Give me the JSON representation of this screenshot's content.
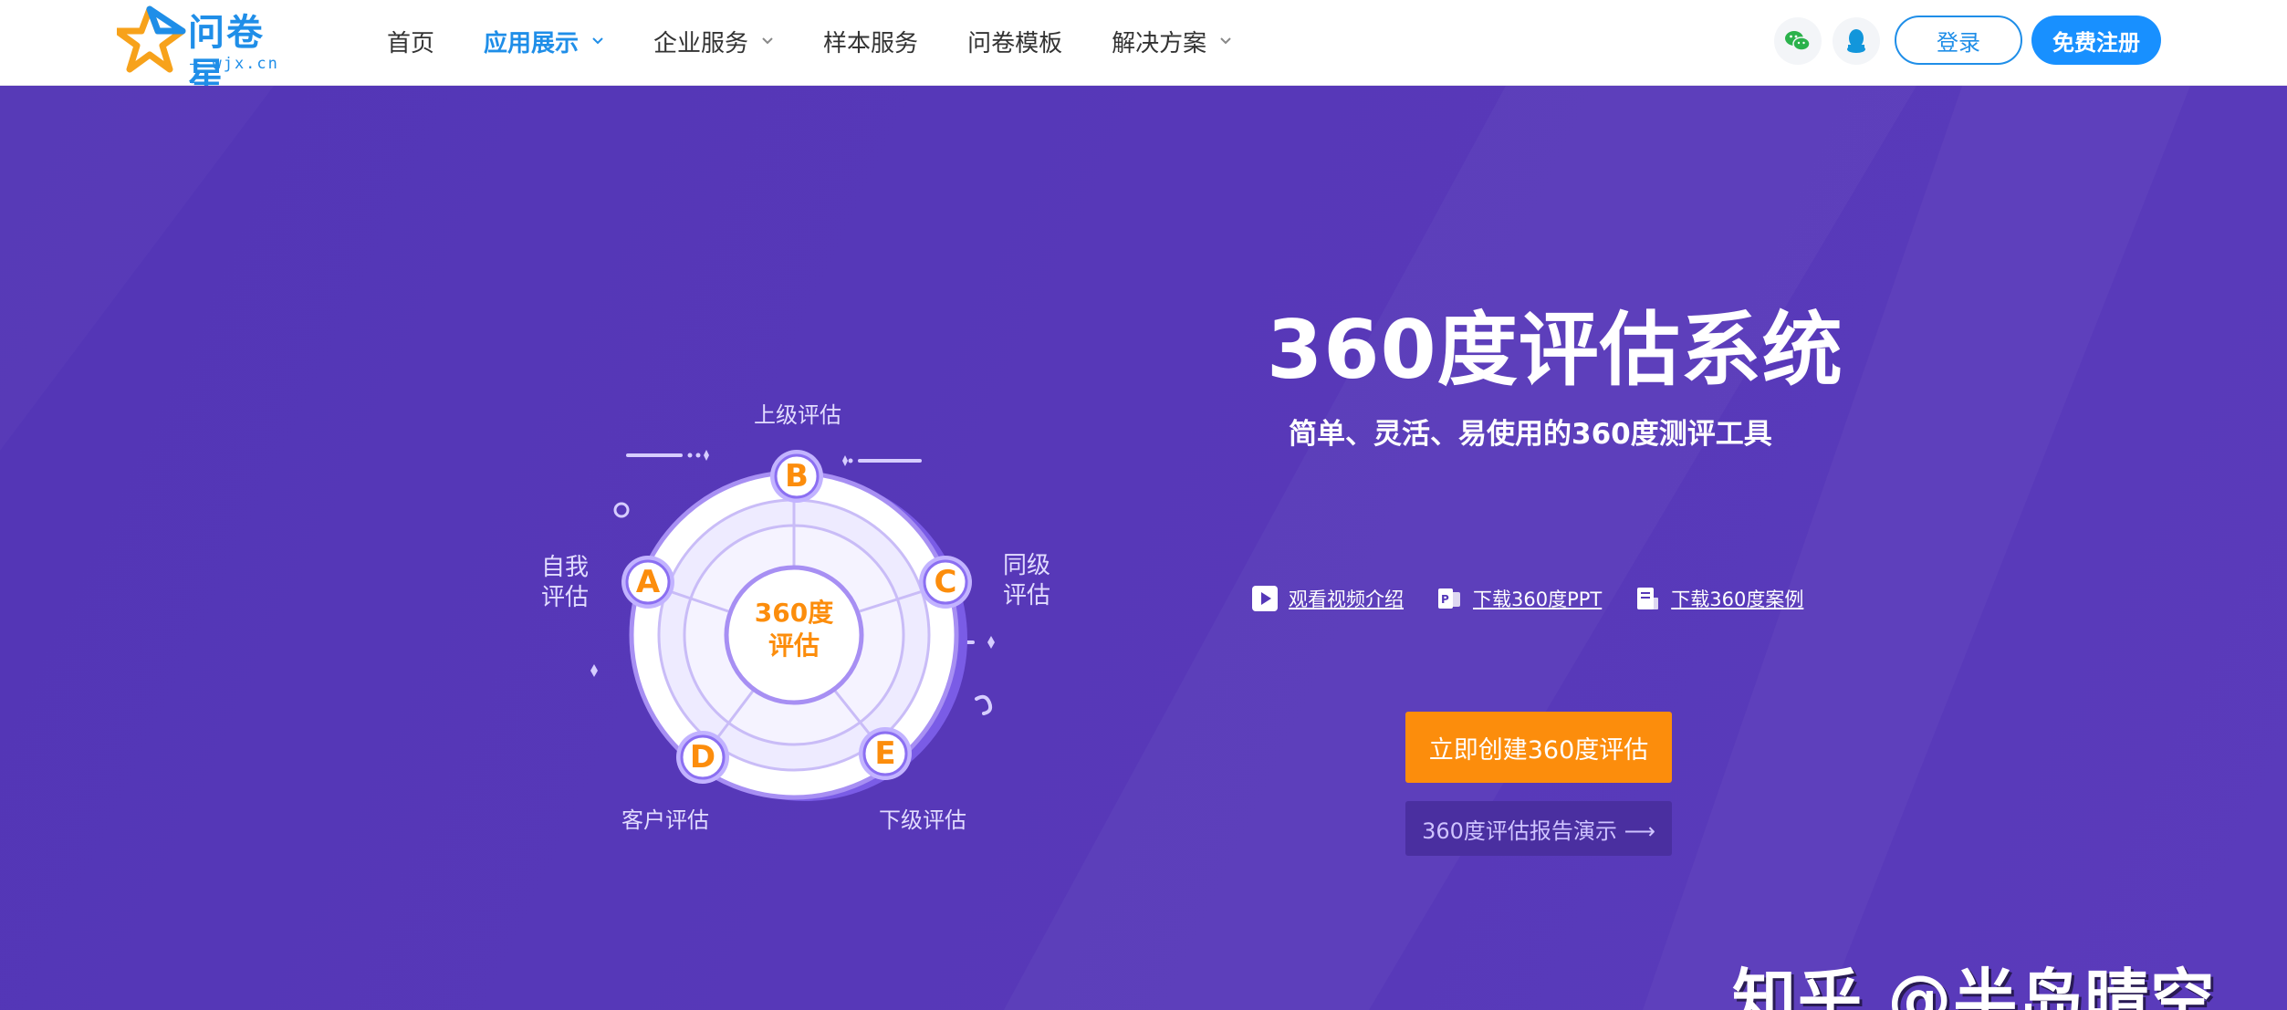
{
  "brand": {
    "name": "问卷星",
    "domain": "— wjx.cn —",
    "colors": {
      "primary": "#1f8ee8",
      "star_orange": "#f7a21b"
    }
  },
  "nav": {
    "items": [
      {
        "label": "首页",
        "active": false,
        "dropdown": false
      },
      {
        "label": "应用展示",
        "active": true,
        "dropdown": true
      },
      {
        "label": "企业服务",
        "active": false,
        "dropdown": true
      },
      {
        "label": "样本服务",
        "active": false,
        "dropdown": false
      },
      {
        "label": "问卷模板",
        "active": false,
        "dropdown": false
      },
      {
        "label": "解决方案",
        "active": false,
        "dropdown": true
      }
    ]
  },
  "header_actions": {
    "wechat_icon": "wechat-icon",
    "qq_icon": "qq-icon",
    "login_label": "登录",
    "register_label": "免费注册"
  },
  "hero": {
    "background": "#5538b8",
    "title": "360度评估系统",
    "subtitle": "简单、灵活、易使用的360度测评工具",
    "links": [
      {
        "label": "观看视频介绍",
        "icon": "play-icon"
      },
      {
        "label": "下载360度PPT",
        "icon": "ppt-icon"
      },
      {
        "label": "下载360度案例",
        "icon": "document-icon"
      }
    ],
    "primary_button": "立即创建360度评估",
    "secondary_button": "360度评估报告演示 ⟶"
  },
  "diagram": {
    "center_line1": "360度",
    "center_line2": "评估",
    "nodes": [
      {
        "letter": "B",
        "label": "上级评估"
      },
      {
        "letter": "A",
        "label_line1": "自我",
        "label_line2": "评估"
      },
      {
        "letter": "C",
        "label_line1": "同级",
        "label_line2": "评估"
      },
      {
        "letter": "D",
        "label": "客户评估"
      },
      {
        "letter": "E",
        "label": "下级评估"
      }
    ]
  },
  "watermark": "知乎 @半岛晴空"
}
